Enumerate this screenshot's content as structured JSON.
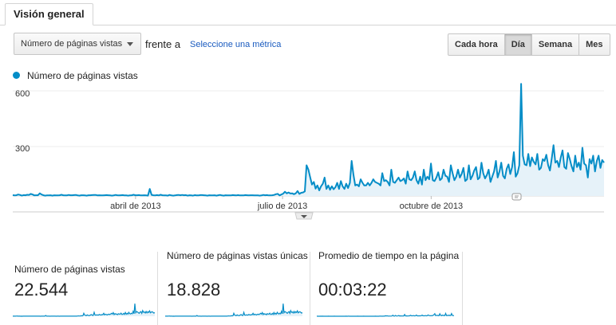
{
  "tabs": {
    "overview": "Visión general"
  },
  "toolbar": {
    "metric_value": "Número de páginas vistas",
    "versus_label": "frente a",
    "select_metric_link": "Seleccione una métrica",
    "granularity": [
      {
        "label": "Cada hora",
        "active": false
      },
      {
        "label": "Día",
        "active": true
      },
      {
        "label": "Semana",
        "active": false
      },
      {
        "label": "Mes",
        "active": false
      }
    ]
  },
  "chart_data": {
    "type": "area",
    "title": "",
    "legend_position": "top-left",
    "series": [
      {
        "name": "Número de páginas vistas",
        "color": "#058dc7"
      }
    ],
    "x_tick_labels": [
      "abril de 2013",
      "julio de 2013",
      "octubre de 2013"
    ],
    "y_ticks": [
      300,
      600
    ],
    "ylim": [
      0,
      630
    ],
    "grid": true,
    "x": {
      "start": "2013-01-15",
      "end": "2014-01-16",
      "unit": "day"
    },
    "values": [
      5,
      3,
      4,
      8,
      6,
      2,
      5,
      4,
      7,
      6,
      12,
      8,
      3,
      4,
      4,
      15,
      8,
      4,
      2,
      3,
      3,
      4,
      2,
      4,
      3,
      3,
      4,
      7,
      4,
      3,
      3,
      6,
      4,
      4,
      5,
      6,
      3,
      2,
      4,
      4,
      3,
      2,
      4,
      4,
      5,
      6,
      6,
      3,
      4,
      3,
      3,
      4,
      5,
      4,
      3,
      2,
      3,
      6,
      4,
      3,
      4,
      5,
      3,
      3,
      2,
      3,
      4,
      7,
      4,
      4,
      5,
      3,
      3,
      4,
      3,
      2,
      40,
      6,
      4,
      3,
      5,
      3,
      7,
      4,
      3,
      3,
      2,
      6,
      3,
      2,
      3,
      5,
      6,
      4,
      6,
      4,
      5,
      2,
      4,
      3,
      2,
      5,
      3,
      3,
      5,
      5,
      4,
      3,
      2,
      4,
      3,
      3,
      4,
      2,
      4,
      6,
      3,
      2,
      4,
      3,
      3,
      3,
      5,
      4,
      3,
      5,
      3,
      3,
      3,
      5,
      4,
      3,
      4,
      4,
      3,
      3,
      3,
      2,
      3,
      6,
      4,
      5,
      3,
      3,
      4,
      6,
      10,
      12,
      3,
      8,
      13,
      24,
      15,
      20,
      14,
      15,
      10,
      15,
      28,
      12,
      18,
      20,
      26,
      175,
      150,
      105,
      65,
      80,
      42,
      60,
      32,
      55,
      70,
      105,
      40,
      60,
      35,
      55,
      38,
      50,
      75,
      40,
      85,
      55,
      40,
      70,
      45,
      75,
      200,
      120,
      60,
      65,
      55,
      95,
      75,
      60,
      60,
      75,
      60,
      75,
      95,
      80,
      75,
      70,
      60,
      130,
      85,
      90,
      80,
      60,
      150,
      80,
      75,
      90,
      105,
      85,
      90,
      100,
      70,
      140,
      95,
      90,
      105,
      140,
      90,
      70,
      110,
      65,
      150,
      90,
      110,
      95,
      185,
      90,
      85,
      105,
      135,
      90,
      100,
      150,
      115,
      110,
      80,
      175,
      130,
      90,
      110,
      150,
      105,
      125,
      160,
      85,
      95,
      175,
      95,
      115,
      145,
      165,
      95,
      105,
      190,
      130,
      100,
      120,
      150,
      80,
      110,
      140,
      200,
      105,
      140,
      190,
      115,
      100,
      155,
      180,
      125,
      165,
      250,
      110,
      130,
      175,
      640,
      230,
      180,
      175,
      240,
      170,
      220,
      195,
      180,
      240,
      150,
      160,
      210,
      200,
      235,
      175,
      145,
      215,
      290,
      190,
      200,
      165,
      220,
      260,
      165,
      155,
      245,
      210,
      170,
      140,
      230,
      165,
      190,
      150,
      275,
      185,
      175,
      105,
      210,
      185,
      230,
      140,
      200,
      230,
      160,
      205,
      190
    ]
  },
  "metrics": [
    {
      "title": "Número de páginas vistas",
      "value": "22.544"
    },
    {
      "title": "Número de páginas vistas únicas",
      "value": "18.828"
    },
    {
      "title": "Promedio de tiempo en la página",
      "value": "00:03:22"
    }
  ]
}
